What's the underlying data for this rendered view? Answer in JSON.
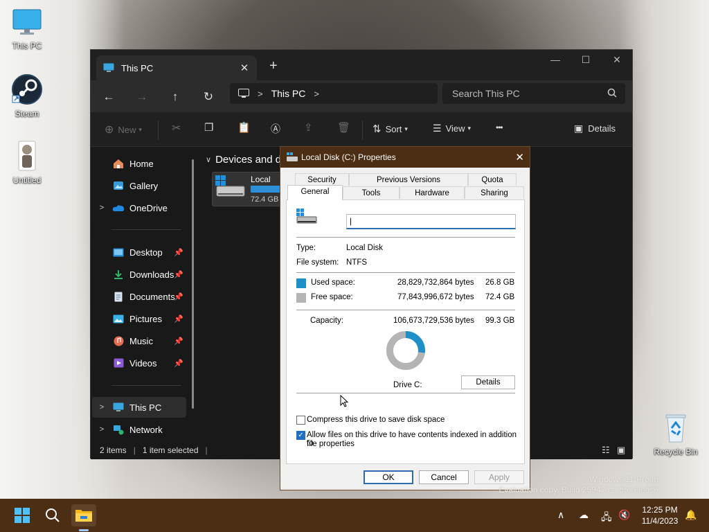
{
  "desktop": {
    "icons": [
      {
        "label": "This PC"
      },
      {
        "label": "Steam"
      },
      {
        "label": "Untitled"
      },
      {
        "label": "Recycle Bin"
      }
    ],
    "watermark": {
      "line1": "Windows 11 Pro In",
      "line2": "Evaluation copy. Build 25947.rs_prerelease"
    }
  },
  "explorer": {
    "tab_title": "This PC",
    "tab_close": "✕",
    "new_tab": "+",
    "address": {
      "location": "This PC"
    },
    "search": {
      "placeholder": "Search This PC"
    },
    "commands": {
      "new": "New",
      "sort": "Sort",
      "view": "View",
      "more": "•••",
      "details": "Details"
    },
    "sidebar": {
      "items": [
        {
          "label": "Home"
        },
        {
          "label": "Gallery"
        },
        {
          "label": "OneDrive"
        },
        {
          "label": "Desktop"
        },
        {
          "label": "Downloads"
        },
        {
          "label": "Documents"
        },
        {
          "label": "Pictures"
        },
        {
          "label": "Music"
        },
        {
          "label": "Videos"
        },
        {
          "label": "This PC"
        },
        {
          "label": "Network"
        }
      ]
    },
    "content": {
      "section_header": "Devices and d",
      "drive_label": "Local Di",
      "drive_size": "72.4 GB"
    },
    "status": {
      "items_count": "2 items",
      "selected": "1 item selected"
    }
  },
  "properties": {
    "title": "Local Disk (C:) Properties",
    "close": "✕",
    "tabs_row1": [
      "Security",
      "Previous Versions",
      "Quota"
    ],
    "tabs_row2": [
      "General",
      "Tools",
      "Hardware",
      "Sharing"
    ],
    "active_tab": "General",
    "drive_name_value": "",
    "type_label": "Type:",
    "type_value": "Local Disk",
    "fs_label": "File system:",
    "fs_value": "NTFS",
    "used_label": "Used space:",
    "used_bytes": "28,829,732,864 bytes",
    "used_gb": "26.8 GB",
    "free_label": "Free space:",
    "free_bytes": "77,843,996,672 bytes",
    "free_gb": "72.4 GB",
    "capacity_label": "Capacity:",
    "capacity_bytes": "106,673,729,536 bytes",
    "capacity_gb": "99.3 GB",
    "used_fraction": 0.27,
    "drive_caption": "Drive C:",
    "details_button": "Details",
    "compress_label": "Compress this drive to save disk space",
    "compress_checked": false,
    "index_label_line1": "Allow files on this drive to have contents indexed in addition to",
    "index_label_line2": "file properties",
    "index_checked": true,
    "ok": "OK",
    "cancel": "Cancel",
    "apply": "Apply",
    "colors": {
      "used": "#1e90c8",
      "free": "#b4b4b4"
    }
  },
  "taskbar": {
    "time": "12:25 PM",
    "date": "11/4/2023"
  }
}
